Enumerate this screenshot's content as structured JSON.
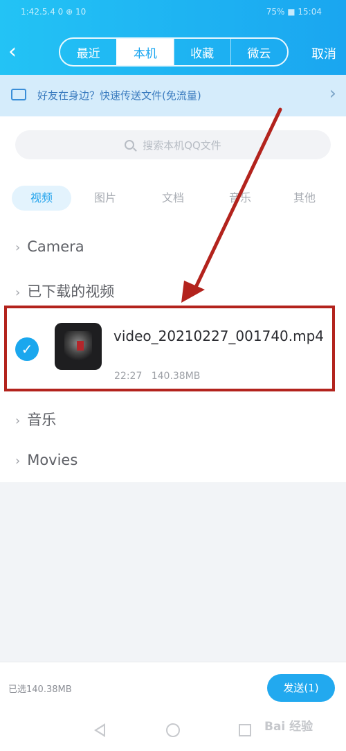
{
  "status": {
    "left": "1:42.5.4 0 ⊕ 10",
    "right": "75% ■ 15:04"
  },
  "header": {
    "back_icon": "back-arrow-icon",
    "tabs": [
      {
        "label": "最近"
      },
      {
        "label": "本机",
        "active": true
      },
      {
        "label": "收藏"
      },
      {
        "label": "微云"
      }
    ],
    "cancel_label": "取消"
  },
  "banner": {
    "icon": "computer-icon",
    "text": "好友在身边？快速传送文件(免流量)",
    "arrow": "›"
  },
  "search": {
    "icon": "search-icon",
    "placeholder": "搜索本机QQ文件"
  },
  "category_tabs": [
    {
      "label": "视频",
      "active": true
    },
    {
      "label": "图片"
    },
    {
      "label": "文档"
    },
    {
      "label": "音乐"
    },
    {
      "label": "其他"
    }
  ],
  "folders": {
    "camera": "Camera",
    "downloaded": "已下载的视频",
    "music": "音乐",
    "movies": "Movies"
  },
  "file_item": {
    "selected": true,
    "name": "video_20210227_001740.mp4",
    "time": "22:27",
    "size": "140.38MB"
  },
  "bottom_bar": {
    "selected_info": "已选140.38MB",
    "send_label": "发送(1)"
  },
  "nav_bar": {
    "back_icon": "nav-back-icon",
    "home_icon": "nav-home-icon",
    "recent_icon": "nav-recent-icon"
  },
  "watermark": "Bai 经验",
  "colors": {
    "accent": "#1aa6f0",
    "highlight_box": "#b3231d"
  }
}
